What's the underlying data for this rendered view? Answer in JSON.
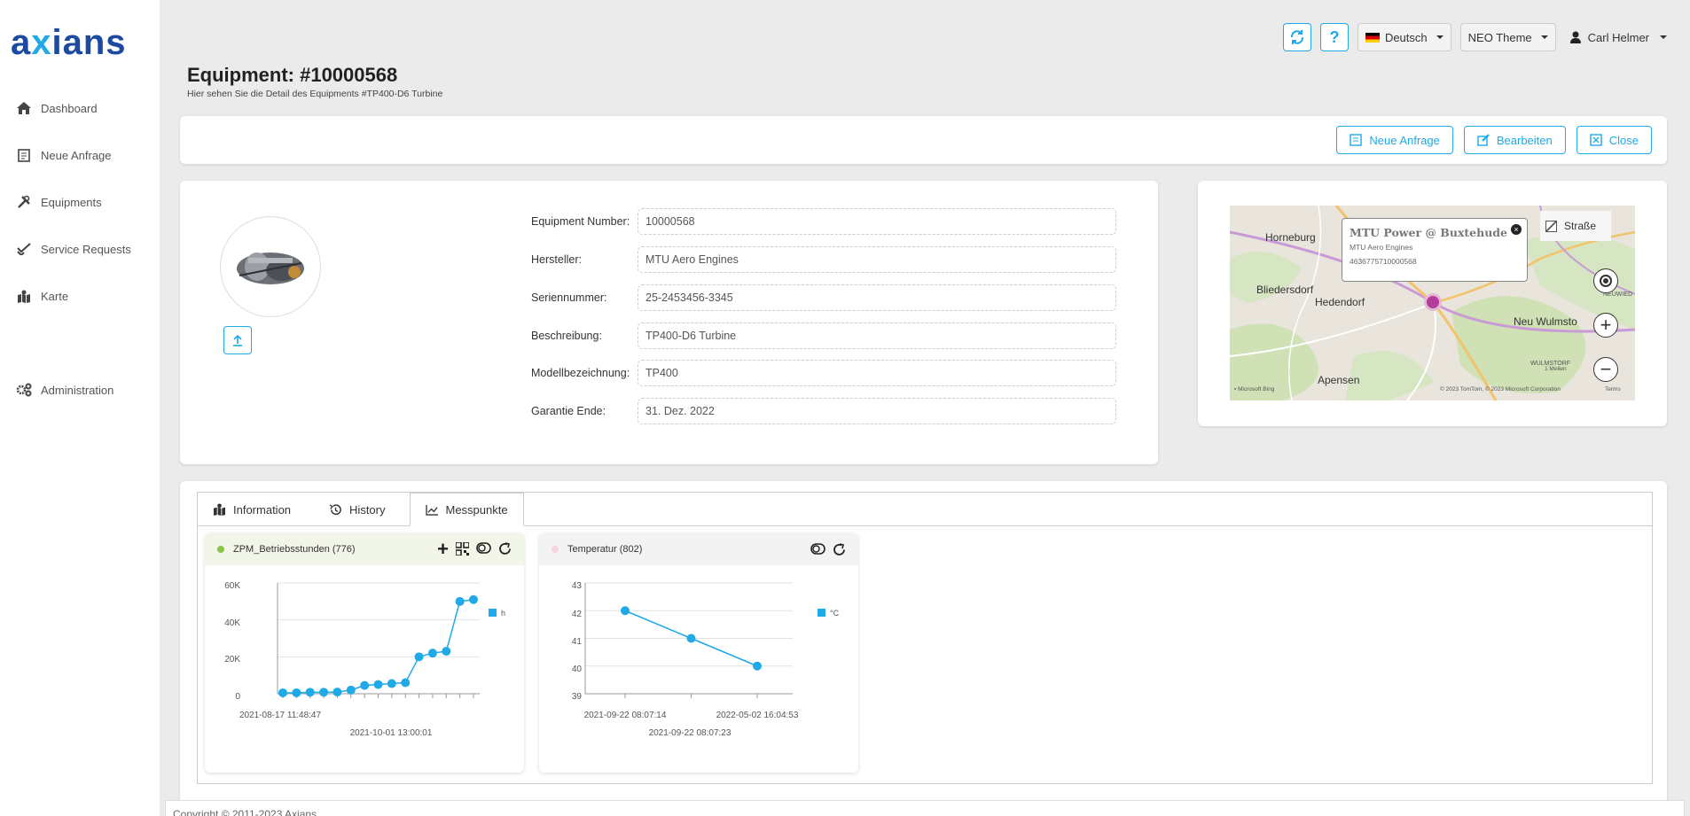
{
  "brand": {
    "logo_text_a": "a",
    "logo_text_x": "x",
    "logo_text_rest": "ians"
  },
  "sidebar": {
    "items": [
      {
        "label": "Dashboard",
        "icon": "home-icon"
      },
      {
        "label": "Neue Anfrage",
        "icon": "form-icon"
      },
      {
        "label": "Equipments",
        "icon": "tools-icon"
      },
      {
        "label": "Service Requests",
        "icon": "check-icon"
      },
      {
        "label": "Karte",
        "icon": "map-icon"
      },
      {
        "label": "Administration",
        "icon": "gears-icon"
      }
    ]
  },
  "topbar": {
    "language": "Deutsch",
    "theme": "NEO Theme",
    "user": "Carl Helmer"
  },
  "header": {
    "title": "Equipment: #10000568",
    "subtitle": "Hier sehen Sie die Detail des Equipments #TP400-D6 Turbine"
  },
  "actions": {
    "new_request": "Neue Anfrage",
    "edit": "Bearbeiten",
    "close": "Close"
  },
  "details": [
    {
      "label": "Equipment Number:",
      "value": "10000568"
    },
    {
      "label": "Hersteller:",
      "value": "MTU Aero Engines"
    },
    {
      "label": "Seriennummer:",
      "value": "25-2453456-3345"
    },
    {
      "label": "Beschreibung:",
      "value": "TP400-D6 Turbine"
    },
    {
      "label": "Modellbezeichnung:",
      "value": "TP400"
    },
    {
      "label": "Garantie Ende:",
      "value": "31. Dez. 2022"
    }
  ],
  "map": {
    "popup_title": "MTU Power @ Buxtehude",
    "popup_company": "MTU Aero Engines",
    "popup_id": "4636775710000568",
    "style_label": "Straße",
    "places": [
      "Horneburg",
      "Bliedersdorf",
      "Hedendorf",
      "Neu Wulmsto",
      "Apensen",
      "NEUWIED",
      "WULMSTORF",
      "NI"
    ],
    "attribution": "© 2023 TomTom, © 2023 Microsoft Corporation",
    "terms": "Terms",
    "bing": "Microsoft Bing",
    "scale": "1 Meilen"
  },
  "tabs": [
    {
      "label": "Information",
      "icon": "map-icon"
    },
    {
      "label": "History",
      "icon": "history-icon"
    },
    {
      "label": "Messpunkte",
      "icon": "chart-icon",
      "active": true
    }
  ],
  "charts": [
    {
      "title": "ZPM_Betriebsstunden (776)",
      "dot_color": "#8bc34a",
      "legend": "h",
      "y_ticks": [
        "60K",
        "40K",
        "20K",
        "0"
      ],
      "x_label_1": "2021-08-17 11:48:47",
      "x_label_2": "2021-10-01 13:00:01"
    },
    {
      "title": "Temperatur (802)",
      "dot_color": "#f5d6de",
      "legend": "°C",
      "y_ticks": [
        "43",
        "42",
        "41",
        "40",
        "39"
      ],
      "x_label_1": "2021-09-22 08:07:14",
      "x_label_2": "2022-05-02 16:04:53",
      "x_label_3": "2021-09-22 08:07:23"
    }
  ],
  "chart_data": [
    {
      "type": "line",
      "title": "ZPM_Betriebsstunden (776)",
      "series": [
        {
          "name": "h",
          "values": [
            500,
            500,
            800,
            800,
            900,
            2000,
            4500,
            5000,
            5500,
            6000,
            20000,
            22000,
            23000,
            50000,
            51000
          ]
        }
      ],
      "ylim": [
        0,
        60000
      ]
    },
    {
      "type": "line",
      "title": "Temperatur (802)",
      "x": [
        "2021-09-22 08:07:14",
        "2021-09-22 08:07:23",
        "2022-05-02 16:04:53"
      ],
      "series": [
        {
          "name": "°C",
          "values": [
            42,
            41,
            40
          ]
        }
      ],
      "ylim": [
        39,
        43
      ]
    }
  ],
  "footer": {
    "text": "Copyright © 2011-2023 Axians"
  },
  "colors": {
    "accent": "#1fa9e6",
    "brand": "#1b4aa0"
  }
}
